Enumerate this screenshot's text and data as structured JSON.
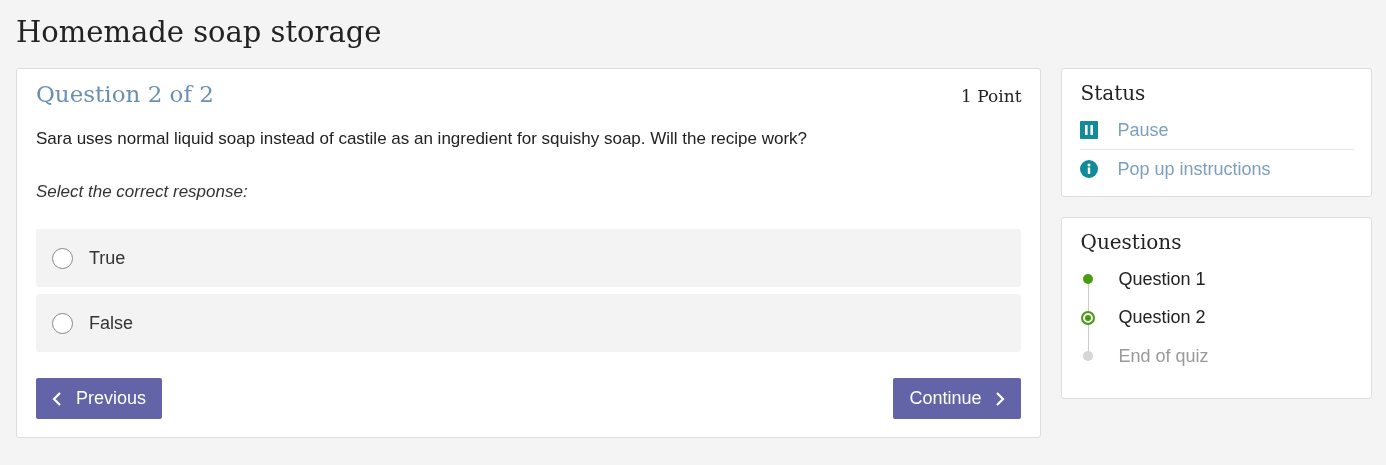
{
  "page_title": "Homemade soap storage",
  "question": {
    "heading": "Question 2 of 2",
    "points": "1 Point",
    "text": "Sara uses normal liquid soap instead of castile as an ingredient for squishy soap. Will the recipe work?",
    "instruction": "Select the correct response:",
    "options": [
      {
        "label": "True",
        "selected": false
      },
      {
        "label": "False",
        "selected": false
      }
    ],
    "previous_button": "Previous",
    "continue_button": "Continue"
  },
  "status": {
    "title": "Status",
    "items": [
      {
        "kind": "pause",
        "label": "Pause"
      },
      {
        "kind": "info",
        "label": "Pop up instructions"
      }
    ]
  },
  "questions": {
    "title": "Questions",
    "items": [
      {
        "label": "Question 1",
        "completed": true,
        "selected": false
      },
      {
        "label": "Question 2",
        "completed": false,
        "selected": true
      },
      {
        "label": "End of quiz",
        "completed": false,
        "selected": false
      }
    ]
  }
}
